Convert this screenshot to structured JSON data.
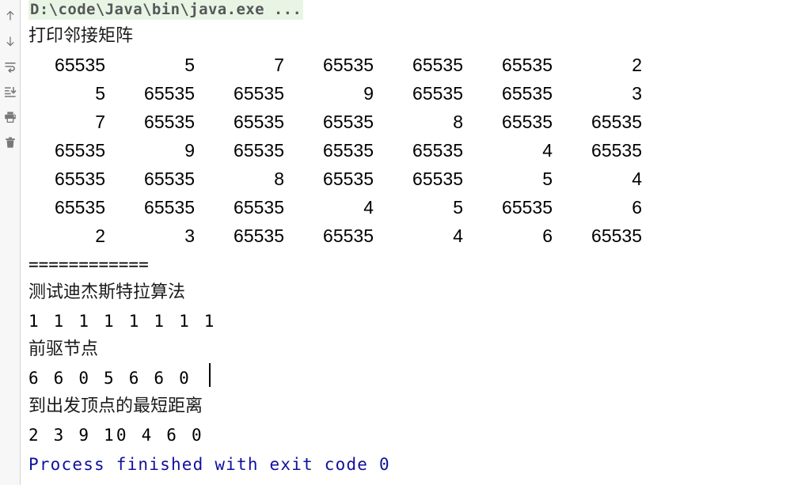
{
  "window": {
    "title": "Run console output",
    "background_color": "#ffffff"
  },
  "gutter": {
    "name": "run-tool-window-toolbar",
    "background_color": "#f7f7f7",
    "icon_color": "#787878",
    "buttons": [
      {
        "name": "up-arrow-icon",
        "label": "Up",
        "tooltip": "Up"
      },
      {
        "name": "down-arrow-icon",
        "label": "Down",
        "tooltip": "Down"
      },
      {
        "name": "soft-wrap-icon",
        "label": "Soft-Wrap",
        "tooltip": "Soft-Wrap"
      },
      {
        "name": "scroll-to-end-icon",
        "label": "Scroll to End",
        "tooltip": "Scroll to End"
      },
      {
        "name": "print-icon",
        "label": "Print",
        "tooltip": "Print"
      },
      {
        "name": "trash-icon",
        "label": "Clear All",
        "tooltip": "Clear All"
      }
    ]
  },
  "console": {
    "command_line": {
      "text": "D:\\code\\Java\\bin\\java.exe ...",
      "highlight_color": "#e9f5e4",
      "text_color": "#55585a"
    },
    "heading_matrix": "打印邻接矩阵",
    "matrix": {
      "infinity_value": "65535",
      "rows": [
        [
          "65535",
          "5",
          "7",
          "65535",
          "65535",
          "65535",
          "2"
        ],
        [
          "5",
          "65535",
          "65535",
          "9",
          "65535",
          "65535",
          "3"
        ],
        [
          "7",
          "65535",
          "65535",
          "65535",
          "8",
          "65535",
          "65535"
        ],
        [
          "65535",
          "9",
          "65535",
          "65535",
          "65535",
          "4",
          "65535"
        ],
        [
          "65535",
          "65535",
          "8",
          "65535",
          "65535",
          "5",
          "4"
        ],
        [
          "65535",
          "65535",
          "65535",
          "4",
          "5",
          "65535",
          "6"
        ],
        [
          "2",
          "3",
          "65535",
          "65535",
          "4",
          "6",
          "65535"
        ]
      ]
    },
    "separator": "============",
    "heading_dijkstra": "测试迪杰斯特拉算法",
    "visited_row": "1 1 1 1 1 1 1 1",
    "heading_predecessor": "前驱节点",
    "predecessor_row": "6 6 0 5 6 6 0 ",
    "heading_distance": "到出发顶点的最短距离",
    "distance_row": "2 3 9 10 4 6 0",
    "exit_message": "Process finished with exit code 0",
    "exit_message_color": "#11109e"
  }
}
